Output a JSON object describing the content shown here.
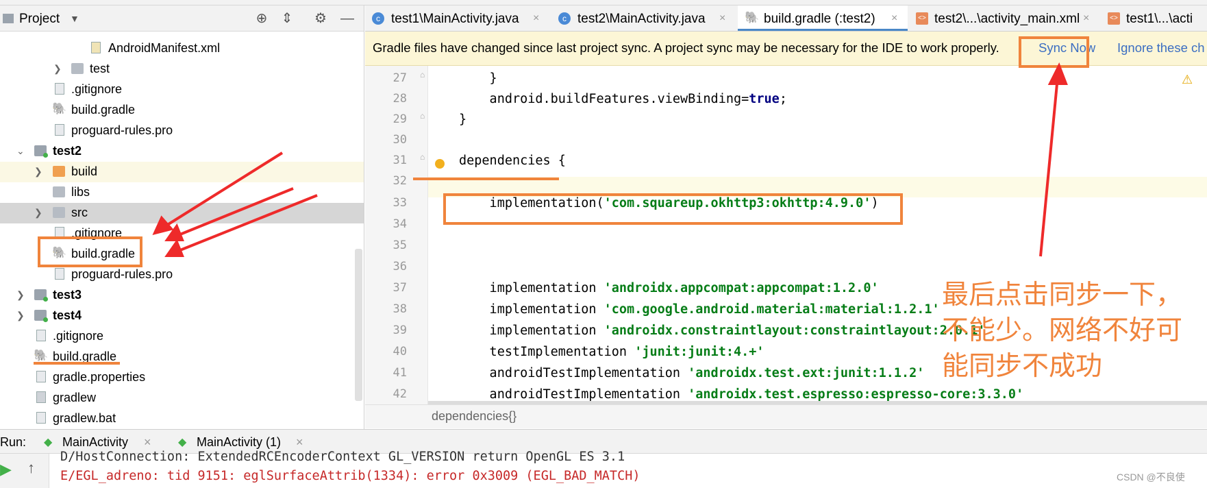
{
  "project": {
    "title": "Project",
    "tree": [
      {
        "label": "AndroidManifest.xml"
      },
      {
        "label": "test"
      },
      {
        "label": ".gitignore"
      },
      {
        "label": "build.gradle"
      },
      {
        "label": "proguard-rules.pro"
      },
      {
        "label": "test2"
      },
      {
        "label": "build"
      },
      {
        "label": "libs"
      },
      {
        "label": "src"
      },
      {
        "label": ".gitignore"
      },
      {
        "label": "build.gradle"
      },
      {
        "label": "proguard-rules.pro"
      },
      {
        "label": "test3"
      },
      {
        "label": "test4"
      },
      {
        "label": ".gitignore"
      },
      {
        "label": "build.gradle"
      },
      {
        "label": "gradle.properties"
      },
      {
        "label": "gradlew"
      },
      {
        "label": "gradlew.bat"
      }
    ]
  },
  "tabs": [
    {
      "label": "test1\\MainActivity.java",
      "close": "×"
    },
    {
      "label": "test2\\MainActivity.java",
      "close": "×"
    },
    {
      "label": "build.gradle (:test2)",
      "close": "×"
    },
    {
      "label": "test2\\...\\activity_main.xml",
      "close": "×"
    },
    {
      "label": "test1\\...\\acti"
    }
  ],
  "banner": {
    "message": "Gradle files have changed since last project sync. A project sync may be necessary for the IDE to work properly.",
    "sync_now": "Sync Now",
    "ignore": "Ignore these ch"
  },
  "editor": {
    "lines": [
      {
        "num": "27",
        "parts": [
          {
            "t": "    }",
            "c": "p"
          }
        ]
      },
      {
        "num": "28",
        "parts": [
          {
            "t": "    android.buildFeatures.viewBinding=",
            "c": "p"
          },
          {
            "t": "true",
            "c": "kw"
          },
          {
            "t": ";",
            "c": "p"
          }
        ]
      },
      {
        "num": "29",
        "parts": [
          {
            "t": "}",
            "c": "p"
          }
        ]
      },
      {
        "num": "30",
        "parts": []
      },
      {
        "num": "31",
        "parts": [
          {
            "t": "dependencies {",
            "c": "p"
          }
        ]
      },
      {
        "num": "32",
        "parts": []
      },
      {
        "num": "33",
        "parts": [
          {
            "t": "    implementation(",
            "c": "p"
          },
          {
            "t": "'com.squareup.okhttp3:okhttp:4.9.0'",
            "c": "str"
          },
          {
            "t": ")",
            "c": "p"
          }
        ]
      },
      {
        "num": "34",
        "parts": []
      },
      {
        "num": "35",
        "parts": []
      },
      {
        "num": "36",
        "parts": []
      },
      {
        "num": "37",
        "parts": [
          {
            "t": "    implementation ",
            "c": "p"
          },
          {
            "t": "'androidx.appcompat:appcompat:1.2.0'",
            "c": "str"
          }
        ]
      },
      {
        "num": "38",
        "parts": [
          {
            "t": "    implementation ",
            "c": "p"
          },
          {
            "t": "'com.google.android.material:material:1.2.1'",
            "c": "str"
          }
        ]
      },
      {
        "num": "39",
        "parts": [
          {
            "t": "    implementation ",
            "c": "p"
          },
          {
            "t": "'androidx.constraintlayout:constraintlayout:2.0.1'",
            "c": "str"
          }
        ]
      },
      {
        "num": "40",
        "parts": [
          {
            "t": "    testImplementation ",
            "c": "p"
          },
          {
            "t": "'junit:junit:4.+'",
            "c": "str"
          }
        ]
      },
      {
        "num": "41",
        "parts": [
          {
            "t": "    androidTestImplementation ",
            "c": "p"
          },
          {
            "t": "'androidx.test.ext:junit:1.1.2'",
            "c": "str"
          }
        ]
      },
      {
        "num": "42",
        "parts": [
          {
            "t": "    androidTestImplementation ",
            "c": "p"
          },
          {
            "t": "'androidx.test.espresso:espresso-core:3.3.0'",
            "c": "str"
          }
        ]
      }
    ],
    "breadcrumb": "dependencies{}"
  },
  "run": {
    "label": "Run:",
    "tabs": [
      {
        "label": "MainActivity",
        "close": "×"
      },
      {
        "label": "MainActivity (1)",
        "close": "×"
      }
    ]
  },
  "console": {
    "line1": "D/HostConnection: ExtendedRCEncoderContext GL_VERSION return OpenGL ES 3.1",
    "line2": "E/EGL_adreno: tid 9151: eglSurfaceAttrib(1334): error 0x3009 (EGL_BAD_MATCH)"
  },
  "annotation": {
    "note": "最后点击同步一下，不能少。网络不好可能同步不成功"
  },
  "watermark": "CSDN @不良使",
  "colors": {
    "annotation": "#f0843c",
    "link": "#3b6ec2",
    "active_tab_underline": "#4a88c7",
    "banner_bg": "#fcf6d6"
  }
}
